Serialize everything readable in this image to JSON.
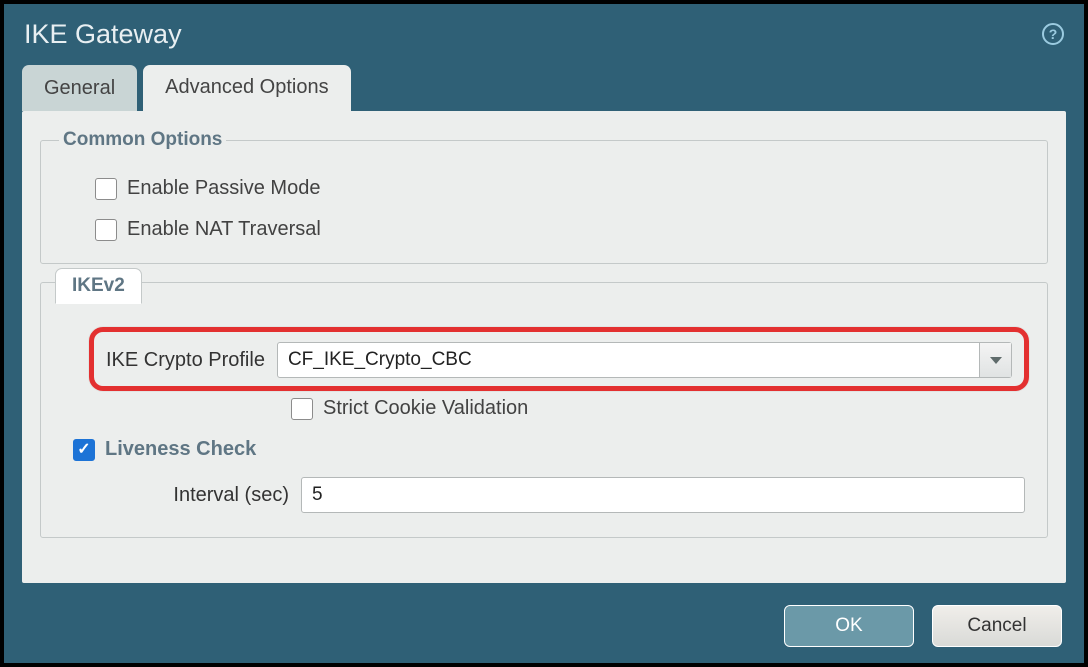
{
  "window": {
    "title": "IKE Gateway"
  },
  "tabs": {
    "general": "General",
    "advanced": "Advanced Options"
  },
  "common_options": {
    "legend": "Common Options",
    "passive_mode": {
      "label": "Enable Passive Mode",
      "checked": false
    },
    "nat_traversal": {
      "label": "Enable NAT Traversal",
      "checked": false
    }
  },
  "ikev2": {
    "tab_label": "IKEv2",
    "profile_label": "IKE Crypto Profile",
    "profile_value": "CF_IKE_Crypto_CBC",
    "strict_cookie": {
      "label": "Strict Cookie Validation",
      "checked": false
    },
    "liveness": {
      "label": "Liveness Check",
      "checked": true
    },
    "interval_label": "Interval (sec)",
    "interval_value": "5"
  },
  "buttons": {
    "ok": "OK",
    "cancel": "Cancel"
  },
  "colors": {
    "header_bg": "#2f6076",
    "panel_bg": "#eceeed",
    "accent_checked": "#1d73d6",
    "highlight_border": "#e33030",
    "btn_ok_bg": "#6b99a8"
  }
}
